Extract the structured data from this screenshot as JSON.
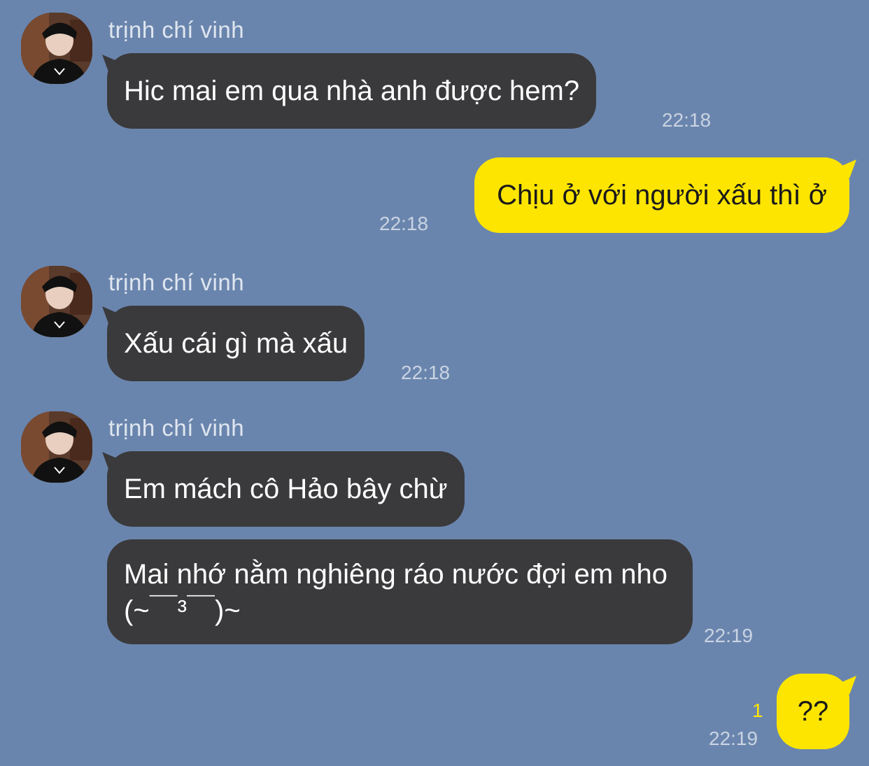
{
  "chat": {
    "messages": [
      {
        "sender": "trịnh chí vinh",
        "text": "Hic mai em qua nhà anh được hem?",
        "time": "22:18"
      },
      {
        "text": "Chịu ở với người xấu thì ở",
        "time": "22:18"
      },
      {
        "sender": "trịnh chí vinh",
        "text": "Xấu cái gì mà xấu",
        "time": "22:18"
      },
      {
        "sender": "trịnh chí vinh",
        "text": "Em mách cô Hảo bây chừ"
      },
      {
        "text": "Mai nhớ nằm nghiêng ráo nước đợi em nho (~￣³￣)~",
        "time": "22:19"
      },
      {
        "text": "??",
        "time": "22:19",
        "unread": "1"
      }
    ]
  },
  "colors": {
    "background": "#6a85ad",
    "incoming_bubble": "#3a3a3c",
    "outgoing_bubble": "#fee500",
    "timestamp": "#c9d3e2",
    "unread_badge": "#fee500"
  },
  "icons": {
    "avatar": "profile-photo"
  }
}
